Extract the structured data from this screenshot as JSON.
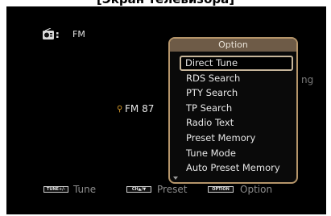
{
  "caption": "[Экран телевизора]",
  "source": {
    "label": "FM",
    "icon": "radio-icon"
  },
  "station": {
    "text": "FM 87",
    "icon": "location-pin-icon"
  },
  "rds_ghost": "ng",
  "option_menu": {
    "title": "Option",
    "items": [
      {
        "label": "Direct Tune",
        "selected": true
      },
      {
        "label": "RDS Search",
        "selected": false
      },
      {
        "label": "PTY Search",
        "selected": false
      },
      {
        "label": "TP Search",
        "selected": false
      },
      {
        "label": "Radio Text",
        "selected": false
      },
      {
        "label": "Preset Memory",
        "selected": false
      },
      {
        "label": "Tune Mode",
        "selected": false
      },
      {
        "label": "Auto Preset Memory",
        "selected": false
      }
    ],
    "more_below_icon": "scroll-down-arrow-icon"
  },
  "bottom_bar": {
    "tune": {
      "chip": "TUNE+/-",
      "label": "Tune"
    },
    "preset": {
      "chip": "CH▲/▼",
      "label": "Preset"
    },
    "option": {
      "chip": "OPTION",
      "label": "Option"
    }
  },
  "colors": {
    "screen_bg": "#000000",
    "panel_border": "#b5956a",
    "panel_header": "#6e5b47",
    "selection_border": "#c7b69b",
    "text": "#e6e6e6",
    "muted_text": "#8d8d8d",
    "pin": "#d79a2a"
  }
}
